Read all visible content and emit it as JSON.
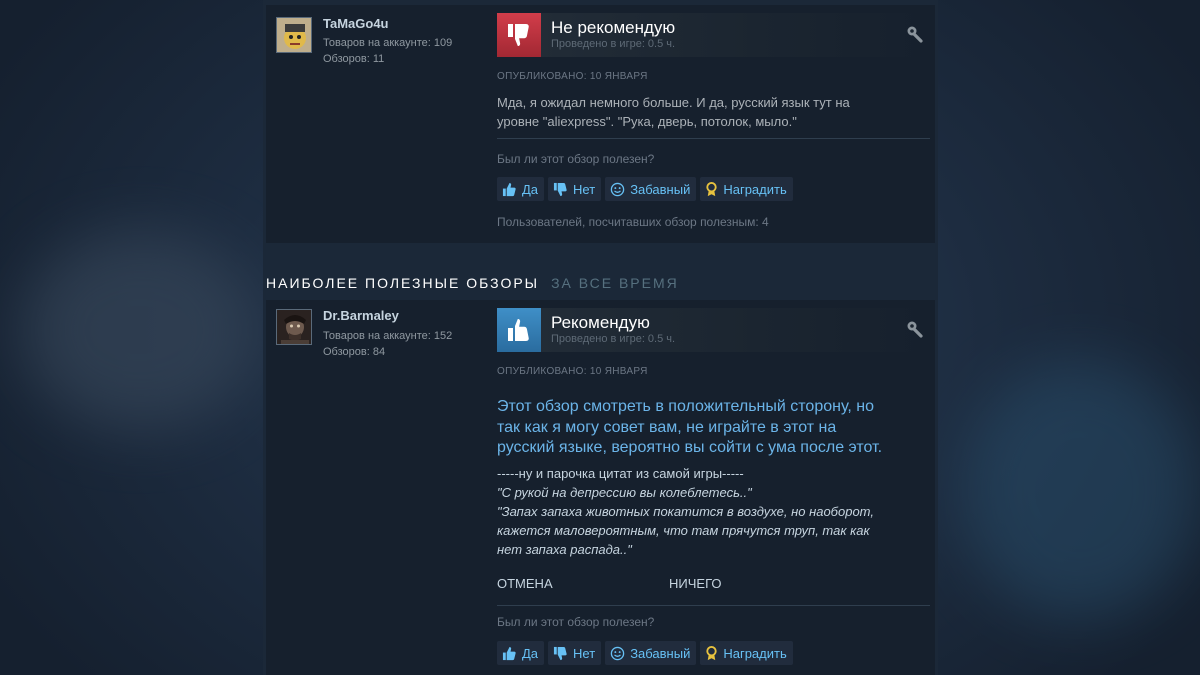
{
  "review1": {
    "username": "TaMaGo4u",
    "products": "Товаров на аккаунте: 109",
    "reviews": "Обзоров: 11",
    "verdict": "Не рекомендую",
    "hours": "Проведено в игре: 0.5 ч.",
    "posted": "ОПУБЛИКОВАНО: 10 ЯНВАРЯ",
    "body_line1": "Мда, я ожидал немного больше. И да, русский язык тут на",
    "body_line2": "уровне \"aliexpress\". \"Рука, дверь, потолок, мыло.\"",
    "helpful_question": "Был ли этот обзор полезен?",
    "btn_yes": "Да",
    "btn_no": "Нет",
    "btn_funny": "Забавный",
    "btn_award": "Наградить",
    "helpful_count": "Пользователей, посчитавших обзор полезным: 4"
  },
  "section": {
    "title": "НАИБОЛЕЕ ПОЛЕЗНЫЕ ОБЗОРЫ",
    "period": "ЗА ВСЕ ВРЕМЯ"
  },
  "review2": {
    "username": "Dr.Barmaley",
    "products": "Товаров на аккаунте: 152",
    "reviews": "Обзоров: 84",
    "verdict": "Рекомендую",
    "hours": "Проведено в игре: 0.5 ч.",
    "posted": "ОПУБЛИКОВАНО: 10 ЯНВАРЯ",
    "quote_line1": "Этот обзор смотреть в положительный сторону, но",
    "quote_line2": "так как я могу совет вам, не играйте в этот на",
    "quote_line3": "русский языке, вероятно вы сойти с ума после этот.",
    "sub_line1": "-----ну и парочка цитат из самой игры-----",
    "sub_line2": "\"С рукой на депрессию вы колеблетесь..\"",
    "sub_line3": "\"Запах запаха животных покатится в воздухе, но наоборот,",
    "sub_line4": "кажется маловероятным, что там прячутся труп, так как",
    "sub_line5": "нет запаха распада..\"",
    "word_left": "ОТМЕНА",
    "word_right": "НИЧЕГО",
    "helpful_question": "Был ли этот обзор полезен?",
    "btn_yes": "Да",
    "btn_no": "Нет",
    "btn_funny": "Забавный",
    "btn_award": "Наградить"
  },
  "colors": {
    "negative": "#c23b44",
    "positive": "#3a86bf",
    "link": "#67c1f5",
    "quote": "#6bb4e8"
  },
  "icons": [
    "thumbs-down-icon",
    "thumbs-up-icon",
    "wrench-icon",
    "smiley-icon",
    "award-icon"
  ]
}
